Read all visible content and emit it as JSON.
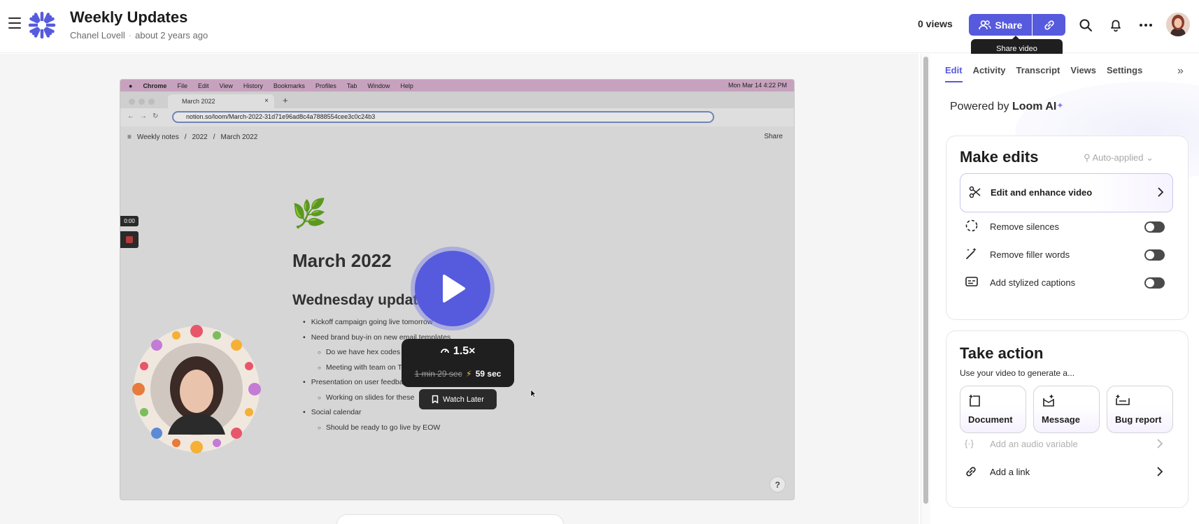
{
  "header": {
    "title": "Weekly Updates",
    "author": "Chanel Lovell",
    "time_ago": "about 2 years ago",
    "views": "0 views",
    "share_label": "Share",
    "share_tooltip": "Share video",
    "accent_color": "#565add"
  },
  "video": {
    "mac_menu": [
      "Chrome",
      "File",
      "Edit",
      "View",
      "History",
      "Bookmarks",
      "Profiles",
      "Tab",
      "Window",
      "Help"
    ],
    "mac_clock": "Mon Mar 14  4:22 PM",
    "tab_title": "March 2022",
    "url": "notion.so/loom/March-2022-31d71e96ad8c4a7888554cee3c0c24b3",
    "breadcrumb": [
      "Weekly notes",
      "2022",
      "March 2022"
    ],
    "notion_share": "Share",
    "doc_title": "March 2022",
    "doc_heading": "Wednesday updates",
    "bullets": [
      {
        "level": 1,
        "text": "Kickoff campaign going live tomorrow"
      },
      {
        "level": 1,
        "text": "Need brand buy-in on new email templates"
      },
      {
        "level": 2,
        "text": "Do we have hex codes fo"
      },
      {
        "level": 2,
        "text": "Meeting with team on Th"
      },
      {
        "level": 1,
        "text": "Presentation on user feedbac"
      },
      {
        "level": 2,
        "text": "Working on slides for these"
      },
      {
        "level": 1,
        "text": "Social calendar"
      },
      {
        "level": 2,
        "text": "Should be ready to go live by EOW"
      }
    ],
    "recording_time": "0:00",
    "speed": "1.5×",
    "original_duration": "1 min 29 sec",
    "new_duration": "59 sec",
    "watch_later": "Watch Later",
    "help": "?"
  },
  "panel": {
    "tabs": [
      "Edit",
      "Activity",
      "Transcript",
      "Views",
      "Settings"
    ],
    "active_tab": "Edit",
    "powered_by": "Powered by",
    "powered_brand": "Loom AI",
    "make_edits": {
      "title": "Make edits",
      "auto_applied": "Auto-applied",
      "enhance": "Edit and enhance video",
      "options": [
        {
          "label": "Remove silences",
          "icon": "silence-icon",
          "on": false
        },
        {
          "label": "Remove filler words",
          "icon": "magic-wand-icon",
          "on": false
        },
        {
          "label": "Add stylized captions",
          "icon": "captions-icon",
          "on": false
        }
      ]
    },
    "take_action": {
      "title": "Take action",
      "description": "Use your video to generate a...",
      "buttons": [
        "Document",
        "Message",
        "Bug report"
      ],
      "audio_variable": "Add an audio variable",
      "add_link": "Add a link"
    }
  }
}
